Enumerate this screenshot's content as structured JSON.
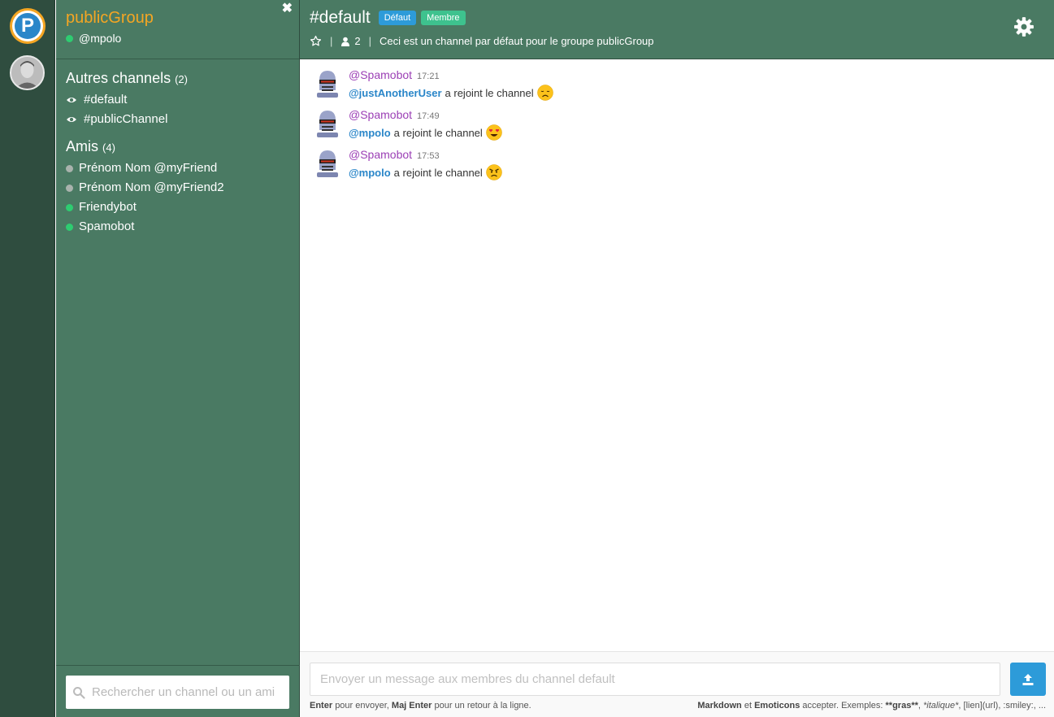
{
  "rail": {
    "group_logo_letter": "P"
  },
  "sidebar": {
    "group_name": "publicGroup",
    "current_user": "@mpolo",
    "close_icon": "✖",
    "channels_title": "Autres channels",
    "channels_count": "(2)",
    "channels": [
      {
        "label": "#default"
      },
      {
        "label": "#publicChannel"
      }
    ],
    "friends_title": "Amis",
    "friends_count": "(4)",
    "friends": [
      {
        "label": "Prénom Nom @myFriend",
        "status": "offline"
      },
      {
        "label": "Prénom Nom @myFriend2",
        "status": "offline"
      },
      {
        "label": "Friendybot",
        "status": "online"
      },
      {
        "label": "Spamobot",
        "status": "online"
      }
    ],
    "search_placeholder": "Rechercher un channel ou un ami"
  },
  "header": {
    "channel_title": "#default",
    "badge_default": "Défaut",
    "badge_member": "Membre",
    "member_count": "2",
    "separator": "|",
    "description": "Ceci est un channel par défaut pour le groupe publicGroup"
  },
  "messages": [
    {
      "author": "@Spamobot",
      "time": "17:21",
      "mention": "@justAnotherUser",
      "text": "a rejoint le channel",
      "emoji": "disappointed-face"
    },
    {
      "author": "@Spamobot",
      "time": "17:49",
      "mention": "@mpolo",
      "text": "a rejoint le channel",
      "emoji": "heart-eyes-face"
    },
    {
      "author": "@Spamobot",
      "time": "17:53",
      "mention": "@mpolo",
      "text": "a rejoint le channel",
      "emoji": "angry-face"
    }
  ],
  "composer": {
    "placeholder": "Envoyer un message aux membres du channel default",
    "hint_enter_key": "Enter",
    "hint_enter_text": "pour envoyer,",
    "hint_shift_key": "Maj Enter",
    "hint_shift_text": "pour un retour à la ligne.",
    "hint_markdown": "Markdown",
    "hint_and": "et",
    "hint_emoticons": "Emoticons",
    "hint_accept": "accepter. Exemples:",
    "hint_bold": "**gras**",
    "hint_italic": "*italique*",
    "hint_rest": ", [lien](url), :smiley:, ..."
  },
  "colors": {
    "sidebar_bg": "#4a7a63",
    "rail_bg": "#2f4d3f",
    "group_name": "#f5a623",
    "author": "#9b3fb5",
    "mention": "#2a86c9",
    "badge_default": "#2d9bd9",
    "badge_member": "#3ec28e",
    "send_button": "#2d9bd9"
  }
}
